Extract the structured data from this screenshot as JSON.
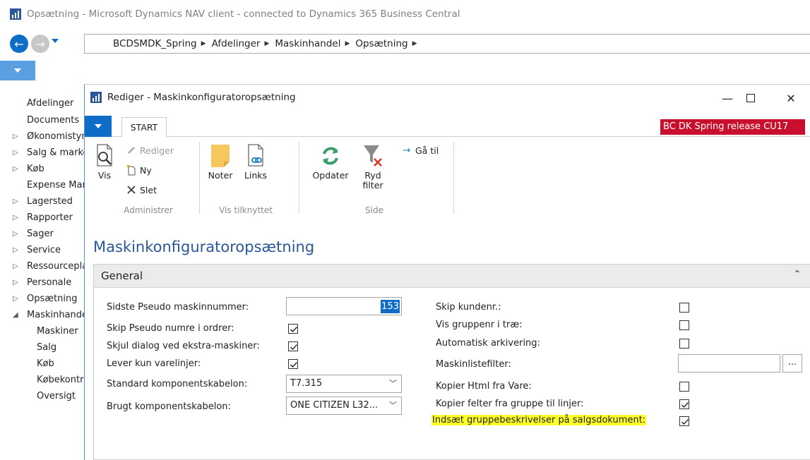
{
  "outer_window": {
    "title": "Opsætning - Microsoft Dynamics NAV client - connected to Dynamics 365 Business Central"
  },
  "breadcrumb": [
    "BCDSMDK_Spring",
    "Afdelinger",
    "Maskinhandel",
    "Opsætning"
  ],
  "sidebar": {
    "items": [
      {
        "label": "Afdelinger",
        "expander": ""
      },
      {
        "label": "Documents",
        "expander": ""
      },
      {
        "label": "Økonomistyring",
        "expander": "▷"
      },
      {
        "label": "Salg & marketing",
        "expander": "▷"
      },
      {
        "label": "Køb",
        "expander": "▷"
      },
      {
        "label": "Expense Management",
        "expander": ""
      },
      {
        "label": "Lagersted",
        "expander": "▷"
      },
      {
        "label": "Rapporter",
        "expander": "▷"
      },
      {
        "label": "Sager",
        "expander": "▷"
      },
      {
        "label": "Service",
        "expander": "▷"
      },
      {
        "label": "Ressourceplanlægning",
        "expander": "▷"
      },
      {
        "label": "Personale",
        "expander": "▷"
      },
      {
        "label": "Opsætning",
        "expander": "▷"
      },
      {
        "label": "Maskinhandel",
        "expander": "◢"
      },
      {
        "label": "Maskiner",
        "expander": ""
      },
      {
        "label": "Salg",
        "expander": ""
      },
      {
        "label": "Køb",
        "expander": ""
      },
      {
        "label": "Købekontrakter",
        "expander": ""
      },
      {
        "label": "Oversigt",
        "expander": ""
      }
    ]
  },
  "dialog": {
    "title": "Rediger - Maskinkonfiguratoropsætning",
    "window_buttons": {
      "minimize": "—",
      "close": "✕"
    },
    "tab_start": "START",
    "release_badge": "BC DK Spring release CU17",
    "ribbon": {
      "groups": {
        "administrer": "Administrer",
        "vis_tilknyttet": "Vis tilknyttet",
        "side": "Side"
      },
      "vis": "Vis",
      "rediger": "Rediger",
      "ny": "Ny",
      "slet": "Slet",
      "noter": "Noter",
      "links": "Links",
      "opdater": "Opdater",
      "ryd_filter_1": "Ryd",
      "ryd_filter_2": "filter",
      "gaa_til": "Gå til"
    },
    "page_title": "Maskinkonfiguratoropsætning",
    "fasttab": {
      "title": "General",
      "left_fields": {
        "sidste_pseudo": {
          "label": "Sidste Pseudo maskinnummer:",
          "value": "153"
        },
        "skip_pseudo": {
          "label": "Skip Pseudo numre i ordrer:",
          "checked": true
        },
        "skjul_dialog": {
          "label": "Skjul dialog ved ekstra-maskiner:",
          "checked": true
        },
        "lever_kun": {
          "label": "Lever kun varelinjer:",
          "checked": true
        },
        "standard_komp": {
          "label": "Standard komponentskabelon:",
          "value": "T7.315"
        },
        "brugt_komp": {
          "label": "Brugt komponentskabelon:",
          "value": "ONE CITIZEN L32..."
        }
      },
      "right_fields": {
        "skip_kundenr": {
          "label": "Skip kundenr.:",
          "checked": false
        },
        "vis_gruppenr": {
          "label": "Vis gruppenr i træ:",
          "checked": false
        },
        "auto_arkiv": {
          "label": "Automatisk arkivering:",
          "checked": false
        },
        "maskinliste": {
          "label": "Maskinlistefilter:",
          "value": "",
          "button": "..."
        },
        "kopier_html": {
          "label": "Kopier Html fra Vare:",
          "checked": false
        },
        "kopier_felter": {
          "label": "Kopier felter fra gruppe til linjer:",
          "checked": true
        },
        "indsaet": {
          "label": "Indsæt gruppebeskrivelser på salgsdokument:",
          "checked": true
        }
      }
    }
  },
  "colors": {
    "accent_blue": "#0e6ec7",
    "title_blue": "#2b579a",
    "badge_red": "#c8102e",
    "highlight_yellow": "#ffff2a"
  }
}
